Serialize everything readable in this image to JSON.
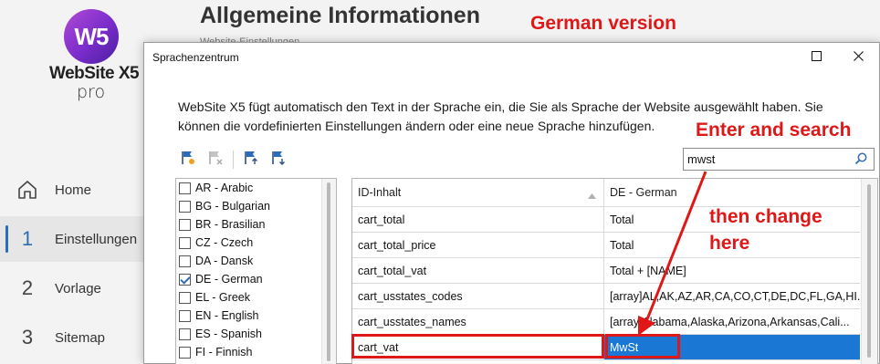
{
  "app": {
    "logo_mark": "W5",
    "logo_name": "WebSite X5",
    "logo_edition": "pro"
  },
  "sidebar": {
    "items": [
      {
        "num": "",
        "label": "Home",
        "icon": "home-icon"
      },
      {
        "num": "1",
        "label": "Einstellungen",
        "active": true
      },
      {
        "num": "2",
        "label": "Vorlage"
      },
      {
        "num": "3",
        "label": "Sitemap"
      }
    ]
  },
  "page": {
    "title": "Allgemeine Informationen",
    "subtitle": "Website-Einstellungen"
  },
  "dialog": {
    "title": "Sprachenzentrum",
    "intro": "WebSite X5 fügt automatisch den Text in der Sprache ein, die Sie als Sprache der Website ausgewählt haben. Sie können die vordefinierten Einstellungen ändern oder eine neue Sprache hinzufügen.",
    "search_value": "mwst",
    "languages": [
      {
        "label": "AR - Arabic",
        "checked": false
      },
      {
        "label": "BG - Bulgarian",
        "checked": false
      },
      {
        "label": "BR - Brasilian",
        "checked": false
      },
      {
        "label": "CZ - Czech",
        "checked": false
      },
      {
        "label": "DA - Dansk",
        "checked": false
      },
      {
        "label": "DE - German",
        "checked": true
      },
      {
        "label": "EL - Greek",
        "checked": false
      },
      {
        "label": "EN - English",
        "checked": false
      },
      {
        "label": "ES - Spanish",
        "checked": false
      },
      {
        "label": "FI - Finnish",
        "checked": false
      }
    ],
    "table": {
      "headers": [
        "ID-Inhalt",
        "DE - German"
      ],
      "rows": [
        {
          "id": "cart_total",
          "value": "Total"
        },
        {
          "id": "cart_total_price",
          "value": "Total"
        },
        {
          "id": "cart_total_vat",
          "value": "Total + [NAME]"
        },
        {
          "id": "cart_usstates_codes",
          "value": "[array]AL,AK,AZ,AR,CA,CO,CT,DE,DC,FL,GA,HI..."
        },
        {
          "id": "cart_usstates_names",
          "value": "[array]Alabama,Alaska,Arizona,Arkansas,Cali..."
        },
        {
          "id": "cart_vat",
          "value": "MwSt",
          "selected": true
        }
      ]
    }
  },
  "annotations": {
    "version": "German version",
    "enter_search": "Enter and search",
    "then_change_1": "then change",
    "then_change_2": "here"
  },
  "colors": {
    "accent": "#2d6cb5",
    "selection": "#1a78d4",
    "annotation": "#e01717",
    "logo_purple": "#7a2ccb"
  }
}
